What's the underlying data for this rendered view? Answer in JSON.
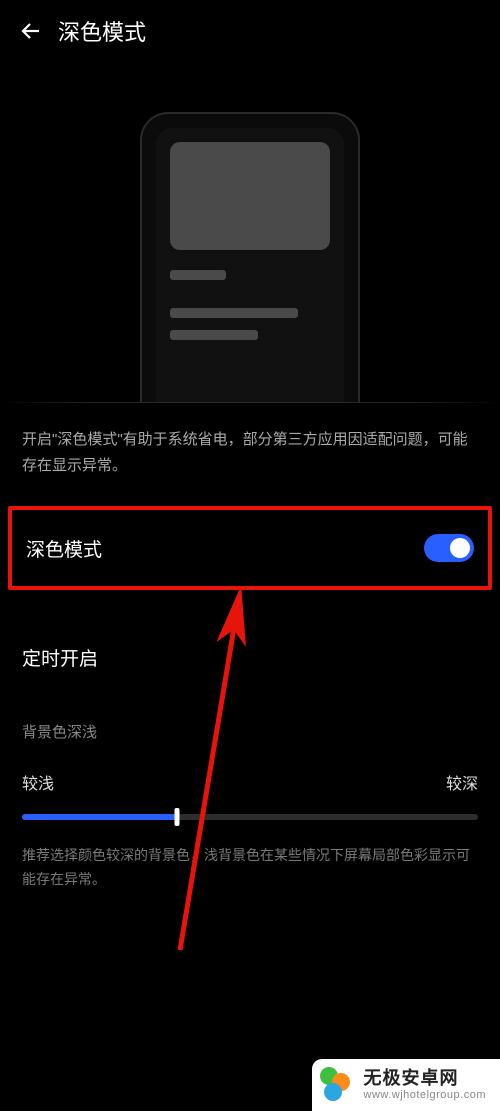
{
  "header": {
    "title": "深色模式"
  },
  "description": "开启\"深色模式\"有助于系统省电，部分第三方应用因适配问题，可能存在显示异常。",
  "dark_mode_toggle": {
    "label": "深色模式",
    "on": true,
    "highlighted": true
  },
  "scheduled": {
    "label": "定时开启"
  },
  "bg_depth": {
    "section_label": "背景色深浅",
    "min_label": "较浅",
    "max_label": "较深",
    "value_percent": 34
  },
  "hint": "推荐选择颜色较深的背景色，浅背景色在某些情况下屏幕局部色彩显示可能存在异常。",
  "watermark": {
    "name": "无极安卓网",
    "url": "www.wjhotelgroup.com"
  }
}
